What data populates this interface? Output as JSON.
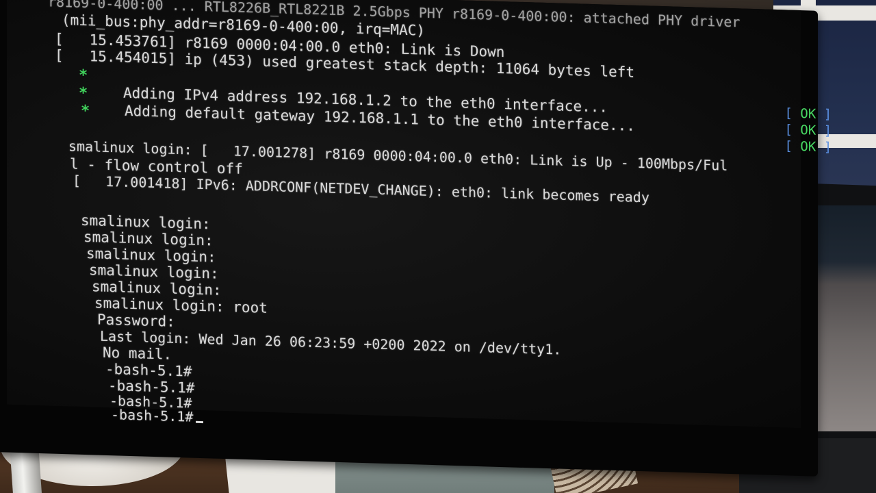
{
  "console": {
    "header_fragment": "r8169-0-400:00 ... RTL8226B_RTL8221B 2.5Gbps PHY r8169-0-400:00: attached PHY driver",
    "line_mii": "(mii_bus:phy_addr=r8169-0-400:00, irq=MAC)",
    "line_link_down": "[   15.453761] r8169 0000:04:00.0 eth0: Link is Down",
    "line_stack": "[   15.454015] ip (453) used greatest stack depth: 11064 bytes left",
    "star": "*",
    "msg_ipv4": "Adding IPv4 address 192.168.1.2 to the eth0 interface...",
    "msg_gateway": "Adding default gateway 192.168.1.1 to the eth0 interface...",
    "ok_open": "[",
    "ok_word": "OK",
    "ok_close": "]",
    "line_login_linkup": "smalinux login: [   17.001278] r8169 0000:04:00.0 eth0: Link is Up - 100Mbps/Ful",
    "line_flow": "l - flow control off",
    "line_ipv6": "[   17.001418] IPv6: ADDRCONF(NETDEV_CHANGE): eth0: link becomes ready",
    "login_prompt": "smalinux login:",
    "login_root": "smalinux login: root",
    "password_prompt": "Password:",
    "last_login": "Last login: Wed Jan 26 06:23:59 +0200 2022 on /dev/tty1.",
    "no_mail": "No mail.",
    "bash_prompt": "-bash-5.1#"
  },
  "colors": {
    "star_green": "#41d25c",
    "ok_green": "#48d863",
    "ok_bracket_blue": "#5a8fe0",
    "console_text": "#d9d9d9"
  }
}
